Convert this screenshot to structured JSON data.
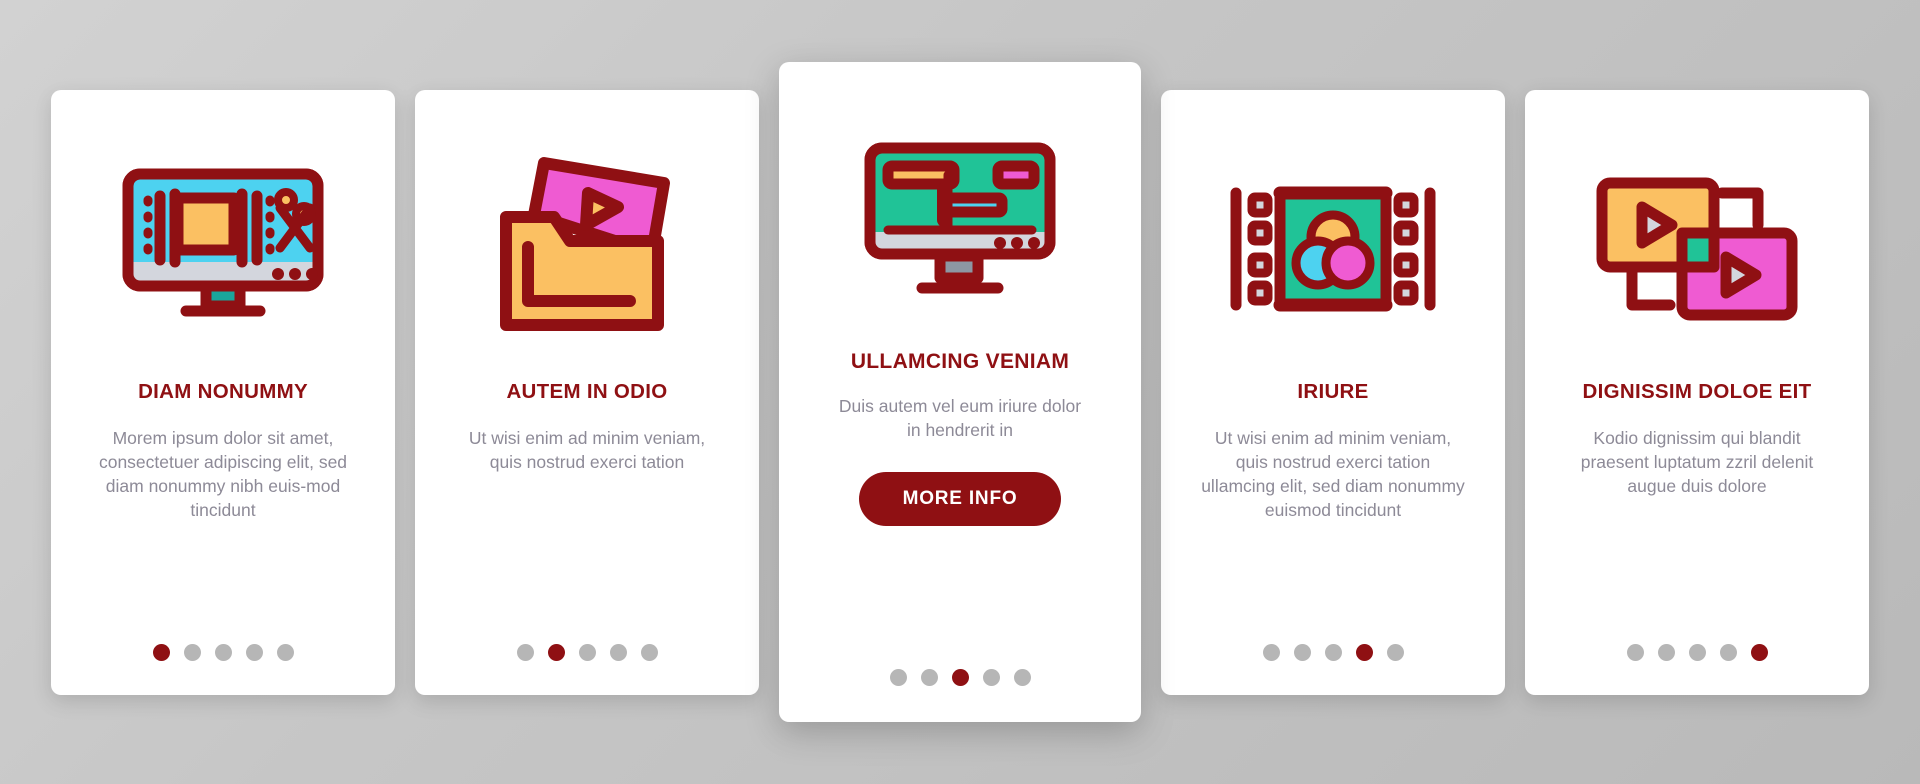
{
  "theme": {
    "accent": "#8f1013",
    "body_text": "#8d8a97",
    "card_bg": "#ffffff",
    "page_bg": "#c9c9c9",
    "dot_inactive": "#b6b6b6",
    "icon_cyan": "#4dd2f0",
    "icon_orange": "#fbc062",
    "icon_pink": "#ef5bd2",
    "icon_green": "#20c397",
    "icon_teal": "#1aa69b",
    "icon_gray": "#d3d6dd"
  },
  "cards": [
    {
      "id": "card-diam-nonummy",
      "icon": "monitor-video-trim-icon",
      "title": "DIAM NONUMMY",
      "body": "Morem ipsum dolor sit amet, consectetuer adipiscing elit, sed diam nonummy nibh euis-mod tincidunt",
      "featured": false,
      "dots": 5,
      "active_dot": 0
    },
    {
      "id": "card-autem-in-odio",
      "icon": "folder-video-icon",
      "title": "AUTEM IN ODIO",
      "body": "Ut wisi enim ad minim veniam, quis nostrud exerci tation",
      "featured": false,
      "dots": 5,
      "active_dot": 1
    },
    {
      "id": "card-ullamcing-veniam",
      "icon": "monitor-timeline-editor-icon",
      "title": "ULLAMCING VENIAM",
      "body": "Duis autem vel eum iriure dolor in hendrerit in",
      "cta_label": "MORE INFO",
      "featured": true,
      "dots": 5,
      "active_dot": 2
    },
    {
      "id": "card-iriure",
      "icon": "filmstrip-color-grading-icon",
      "title": "IRIURE",
      "body": "Ut wisi enim ad minim veniam, quis nostrud exerci tation ullamcing elit, sed diam nonummy euismod tincidunt",
      "featured": false,
      "dots": 5,
      "active_dot": 3
    },
    {
      "id": "card-dignissim-doloe-eit",
      "icon": "two-video-frames-icon",
      "title": "DIGNISSIM DOLOE EIT",
      "body": "Kodio dignissim qui blandit praesent luptatum zzril delenit augue duis dolore",
      "featured": false,
      "dots": 5,
      "active_dot": 4
    }
  ]
}
